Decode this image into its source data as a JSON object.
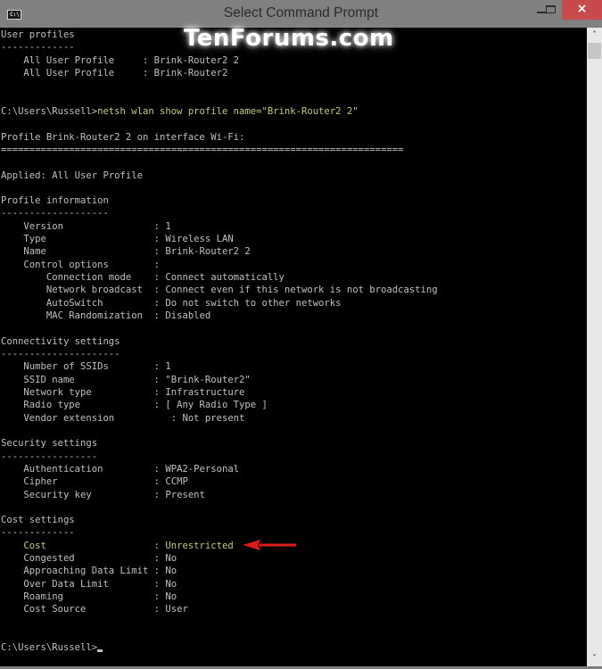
{
  "window": {
    "title": "Select Command Prompt",
    "icon": "cmd-icon",
    "icon_text": "C:\\.",
    "controls": {
      "minimize": "minimize-icon",
      "maximize": "maximize-icon",
      "close": "×"
    }
  },
  "watermark": "TenForums.com",
  "console": {
    "lines": [
      {
        "text": "User profiles",
        "color": "default"
      },
      {
        "text": "-------------",
        "color": "default"
      },
      {
        "text": "    All User Profile     : Brink-Router2 2",
        "color": "default"
      },
      {
        "text": "    All User Profile     : Brink-Router2",
        "color": "default"
      },
      {
        "text": "",
        "color": "default"
      },
      {
        "text": "",
        "color": "default"
      },
      {
        "text": "C:\\Users\\Russell>",
        "command": "netsh wlan show profile name=\"Brink-Router2 2\"",
        "color": "prompt"
      },
      {
        "text": "",
        "color": "default"
      },
      {
        "text": "Profile Brink-Router2 2 on interface Wi-Fi:",
        "color": "default"
      },
      {
        "text": "=======================================================================",
        "color": "default"
      },
      {
        "text": "",
        "color": "default"
      },
      {
        "text": "Applied: All User Profile",
        "color": "default"
      },
      {
        "text": "",
        "color": "default"
      },
      {
        "text": "Profile information",
        "color": "default"
      },
      {
        "text": "-------------------",
        "color": "default"
      },
      {
        "text": "    Version                : 1",
        "color": "default"
      },
      {
        "text": "    Type                   : Wireless LAN",
        "color": "default"
      },
      {
        "text": "    Name                   : Brink-Router2 2",
        "color": "default"
      },
      {
        "text": "    Control options        :",
        "color": "default"
      },
      {
        "text": "        Connection mode    : Connect automatically",
        "color": "default"
      },
      {
        "text": "        Network broadcast  : Connect even if this network is not broadcasting",
        "color": "default"
      },
      {
        "text": "        AutoSwitch         : Do not switch to other networks",
        "color": "default"
      },
      {
        "text": "        MAC Randomization  : Disabled",
        "color": "default"
      },
      {
        "text": "",
        "color": "default"
      },
      {
        "text": "Connectivity settings",
        "color": "default"
      },
      {
        "text": "---------------------",
        "color": "default"
      },
      {
        "text": "    Number of SSIDs        : 1",
        "color": "default"
      },
      {
        "text": "    SSID name              : \"Brink-Router2\"",
        "color": "default"
      },
      {
        "text": "    Network type           : Infrastructure",
        "color": "default"
      },
      {
        "text": "    Radio type             : [ Any Radio Type ]",
        "color": "default"
      },
      {
        "text": "    Vendor extension          : Not present",
        "color": "default"
      },
      {
        "text": "",
        "color": "default"
      },
      {
        "text": "Security settings",
        "color": "default"
      },
      {
        "text": "-----------------",
        "color": "default"
      },
      {
        "text": "    Authentication         : WPA2-Personal",
        "color": "default"
      },
      {
        "text": "    Cipher                 : CCMP",
        "color": "default"
      },
      {
        "text": "    Security key           : Present",
        "color": "default"
      },
      {
        "text": "",
        "color": "default"
      },
      {
        "text": "Cost settings",
        "color": "default"
      },
      {
        "text": "-------------",
        "color": "default"
      },
      {
        "text": "    Cost                   : Unrestricted",
        "color": "highlight"
      },
      {
        "text": "    Congested              : No",
        "color": "default"
      },
      {
        "text": "    Approaching Data Limit : No",
        "color": "default"
      },
      {
        "text": "    Over Data Limit        : No",
        "color": "default"
      },
      {
        "text": "    Roaming                : No",
        "color": "default"
      },
      {
        "text": "    Cost Source            : User",
        "color": "default"
      },
      {
        "text": "",
        "color": "default"
      },
      {
        "text": "",
        "color": "default"
      },
      {
        "text": "C:\\Users\\Russell>",
        "cursor": true,
        "color": "default"
      }
    ]
  },
  "annotation": {
    "type": "arrow",
    "color": "#e01b1b",
    "points_to": "Cost : Unrestricted"
  },
  "colors": {
    "console_bg": "#000000",
    "console_text": "#c0c0c0",
    "highlight_text": "#c8c87a",
    "titlebar": "#808080",
    "close_button": "#c94a4a"
  }
}
